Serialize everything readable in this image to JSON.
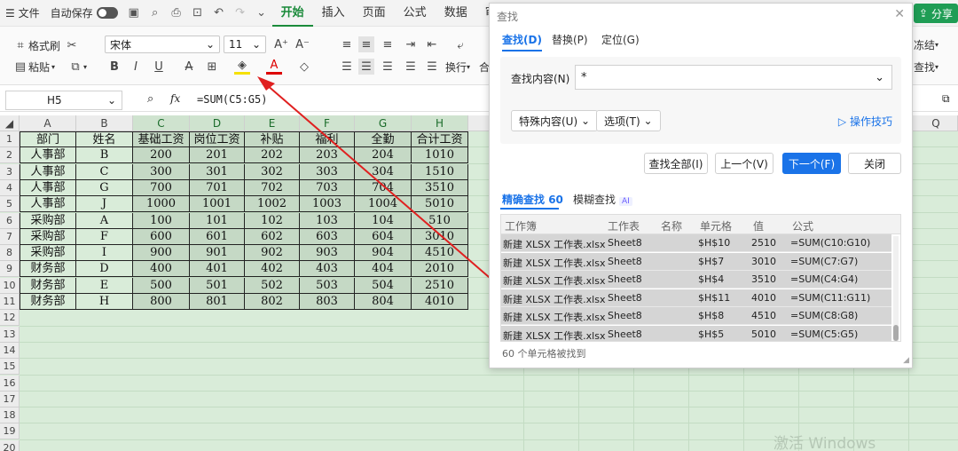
{
  "titlebar": {
    "file": "文件",
    "autosave": "自动保存",
    "tabs": [
      "开始",
      "插入",
      "页面",
      "公式",
      "数据",
      "审阅"
    ],
    "share": "分享"
  },
  "ribbon": {
    "format_painter": "格式刷",
    "paste": "粘贴",
    "font_name": "宋体",
    "font_size": "11",
    "wrap": "换行",
    "freeze": "冻结",
    "find": "查找",
    "merge_prefix": "合"
  },
  "formula_bar": {
    "cell_ref": "H5",
    "fx": "fx",
    "formula": "=SUM(C5:G5)"
  },
  "sheet": {
    "columns": [
      "A",
      "B",
      "C",
      "D",
      "E",
      "F",
      "G",
      "H"
    ],
    "extra_column": "Q",
    "rows": [
      "1",
      "2",
      "3",
      "4",
      "5",
      "6",
      "7",
      "8",
      "9",
      "10",
      "11",
      "12",
      "13",
      "14",
      "15",
      "16",
      "17",
      "18",
      "19",
      "20"
    ],
    "headers": [
      "部门",
      "姓名",
      "基础工资",
      "岗位工资",
      "补贴",
      "福利",
      "全勤",
      "合计工资"
    ],
    "data": [
      [
        "人事部",
        "B",
        "200",
        "201",
        "202",
        "203",
        "204",
        "1010"
      ],
      [
        "人事部",
        "C",
        "300",
        "301",
        "302",
        "303",
        "304",
        "1510"
      ],
      [
        "人事部",
        "G",
        "700",
        "701",
        "702",
        "703",
        "704",
        "3510"
      ],
      [
        "人事部",
        "J",
        "1000",
        "1001",
        "1002",
        "1003",
        "1004",
        "5010"
      ],
      [
        "采购部",
        "A",
        "100",
        "101",
        "102",
        "103",
        "104",
        "510"
      ],
      [
        "采购部",
        "F",
        "600",
        "601",
        "602",
        "603",
        "604",
        "3010"
      ],
      [
        "采购部",
        "I",
        "900",
        "901",
        "902",
        "903",
        "904",
        "4510"
      ],
      [
        "财务部",
        "D",
        "400",
        "401",
        "402",
        "403",
        "404",
        "2010"
      ],
      [
        "财务部",
        "E",
        "500",
        "501",
        "502",
        "503",
        "504",
        "2510"
      ],
      [
        "财务部",
        "H",
        "800",
        "801",
        "802",
        "803",
        "804",
        "4010"
      ]
    ]
  },
  "dialog": {
    "title": "查找",
    "tabs": [
      "查找(D)",
      "替换(P)",
      "定位(G)"
    ],
    "find_label": "查找内容(N)",
    "find_value": "*",
    "special": "特殊内容(U)",
    "options": "选项(T)",
    "tips": "操作技巧",
    "buttons": [
      "查找全部(I)",
      "上一个(V)",
      "下一个(F)",
      "关闭"
    ],
    "mode_exact": "精确查找",
    "mode_exact_count": "60",
    "mode_fuzzy": "模糊查找",
    "ai": "AI",
    "result_headers": [
      "工作簿",
      "工作表",
      "名称",
      "单元格",
      "值",
      "公式"
    ],
    "results": [
      [
        "新建 XLSX 工作表.xlsx",
        "Sheet8",
        "",
        "$H$10",
        "2510",
        "=SUM(C10:G10)"
      ],
      [
        "新建 XLSX 工作表.xlsx",
        "Sheet8",
        "",
        "$H$7",
        "3010",
        "=SUM(C7:G7)"
      ],
      [
        "新建 XLSX 工作表.xlsx",
        "Sheet8",
        "",
        "$H$4",
        "3510",
        "=SUM(C4:G4)"
      ],
      [
        "新建 XLSX 工作表.xlsx",
        "Sheet8",
        "",
        "$H$11",
        "4010",
        "=SUM(C11:G11)"
      ],
      [
        "新建 XLSX 工作表.xlsx",
        "Sheet8",
        "",
        "$H$8",
        "4510",
        "=SUM(C8:G8)"
      ],
      [
        "新建 XLSX 工作表.xlsx",
        "Sheet8",
        "",
        "$H$5",
        "5010",
        "=SUM(C5:G5)"
      ]
    ],
    "status": "60 个单元格被找到"
  },
  "watermark": "激活 Windows",
  "colors": {
    "accent_green": "#1a8a3a",
    "accent_blue": "#1a73e8",
    "arrow_red": "#e02020"
  }
}
